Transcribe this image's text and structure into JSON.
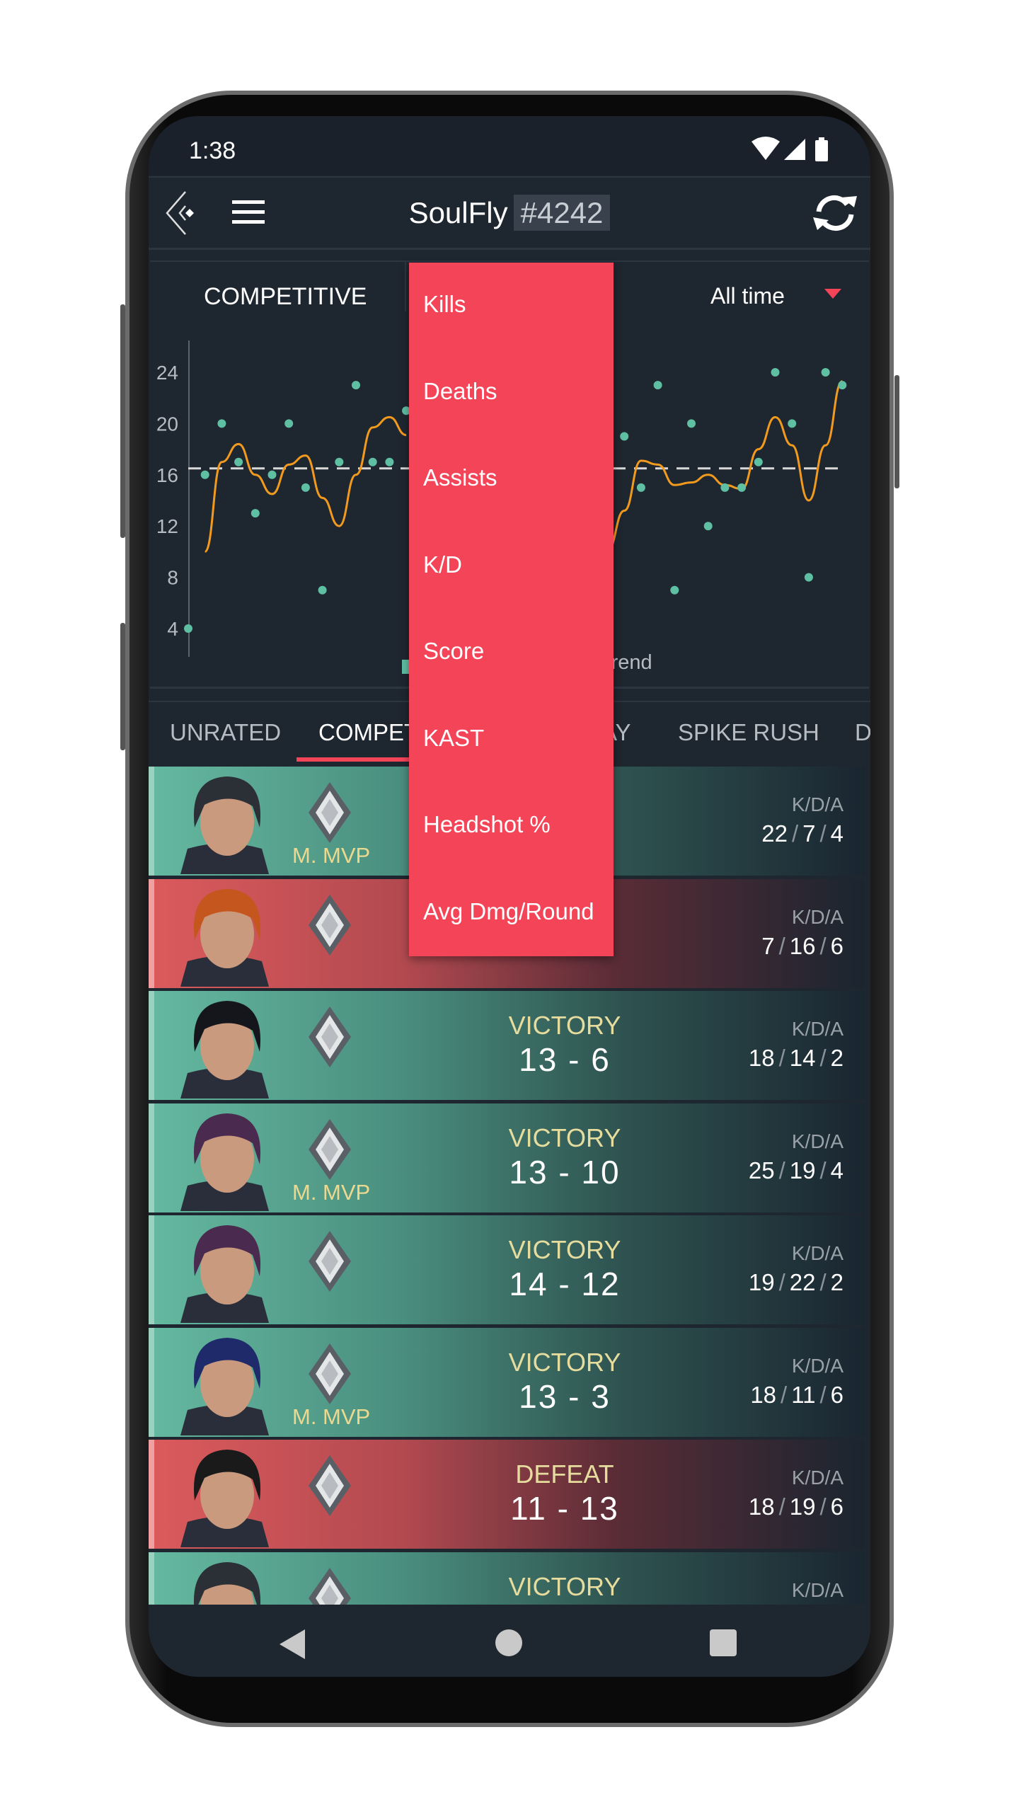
{
  "status_bar": {
    "time": "1:38",
    "icons": [
      "wifi-icon",
      "signal-icon",
      "battery-icon"
    ]
  },
  "header": {
    "player_name": "SoulFly",
    "player_tag": "#4242",
    "back_icon": "back-logo-icon",
    "menu_icon": "hamburger-icon",
    "refresh_icon": "refresh-icon"
  },
  "chart_panel": {
    "mode": "COMPETITIVE",
    "period": "All time",
    "legend_trend": "Trend"
  },
  "chart_data": {
    "type": "scatter",
    "y_ticks": [
      4,
      8,
      12,
      16,
      20,
      24
    ],
    "ylim": [
      4,
      24
    ],
    "grid": false,
    "average": 16.5,
    "colors": {
      "points": "#5fbfa3",
      "trend": "#f29a1e",
      "average": "#d8d8d8"
    },
    "points": [
      4,
      16,
      20,
      17,
      13,
      16,
      20,
      15,
      7,
      17,
      23,
      17,
      17,
      21,
      null,
      null,
      null,
      null,
      null,
      null,
      null,
      null,
      null,
      null,
      null,
      null,
      19,
      15,
      23,
      7,
      20,
      12,
      15,
      15,
      17,
      24,
      20,
      8,
      24,
      23
    ],
    "trend": [
      null,
      10,
      17,
      18.4,
      16,
      14.5,
      16.8,
      17.5,
      14.2,
      12,
      16,
      19.7,
      20.5,
      19.1,
      null,
      null,
      null,
      null,
      null,
      null,
      null,
      null,
      null,
      null,
      null,
      10.1,
      13.2,
      17.1,
      16.8,
      15.2,
      15.4,
      16,
      15.2,
      14.9,
      18,
      20.5,
      18.3,
      14,
      18.3,
      23.3
    ]
  },
  "dropdown": {
    "items": [
      "Kills",
      "Deaths",
      "Assists",
      "K/D",
      "Score",
      "KAST",
      "Headshot %",
      "Avg Dmg/Round"
    ]
  },
  "tabs": [
    {
      "label": "UNRATED"
    },
    {
      "label": "COMPETITIVE",
      "active": true
    },
    {
      "label": "AY"
    },
    {
      "label": "SPIKE RUSH"
    },
    {
      "label": "D"
    }
  ],
  "kda_label": "K/D/A",
  "matches": [
    {
      "outcome": "victory",
      "result": "",
      "score": "",
      "mvp": "M. MVP",
      "k": "22",
      "d": "7",
      "a": "4",
      "hair": "#2b2f36"
    },
    {
      "outcome": "defeat",
      "result": "",
      "score": "",
      "mvp": "",
      "k": "7",
      "d": "16",
      "a": "6",
      "hair": "#c5561e"
    },
    {
      "outcome": "victory",
      "result": "VICTORY",
      "score": "13 - 6",
      "mvp": "",
      "k": "18",
      "d": "14",
      "a": "2",
      "hair": "#15161c"
    },
    {
      "outcome": "victory",
      "result": "VICTORY",
      "score": "13 - 10",
      "mvp": "M. MVP",
      "k": "25",
      "d": "19",
      "a": "4",
      "hair": "#4a2a4e"
    },
    {
      "outcome": "victory",
      "result": "VICTORY",
      "score": "14 - 12",
      "mvp": "",
      "k": "19",
      "d": "22",
      "a": "2",
      "hair": "#4a2a4e"
    },
    {
      "outcome": "victory",
      "result": "VICTORY",
      "score": "13 - 3",
      "mvp": "M. MVP",
      "k": "18",
      "d": "11",
      "a": "6",
      "hair": "#1e2a6a"
    },
    {
      "outcome": "defeat",
      "result": "DEFEAT",
      "score": "11 - 13",
      "mvp": "",
      "k": "18",
      "d": "19",
      "a": "6",
      "hair": "#1a1a1a"
    },
    {
      "outcome": "victory",
      "result": "VICTORY",
      "score": "",
      "mvp": "",
      "k": "",
      "d": "",
      "a": "",
      "hair": "#2b2f36"
    }
  ],
  "colors": {
    "accent": "#f44458",
    "victory": "#64b8a0",
    "defeat": "#db5a5c",
    "gold": "#e6dc9e",
    "background": "#1e2630"
  }
}
